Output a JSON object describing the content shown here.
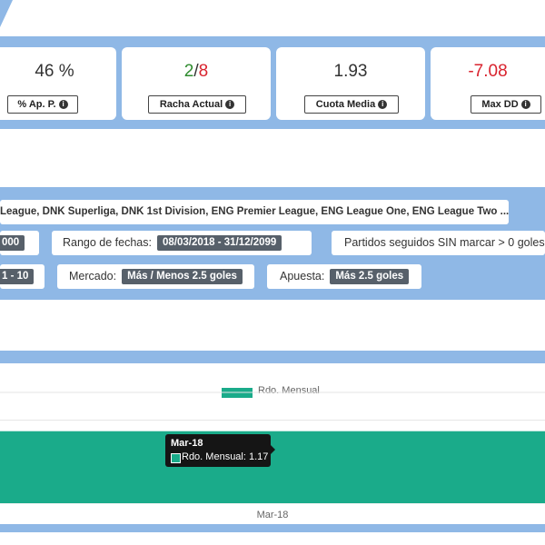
{
  "stats": [
    {
      "value": "46 %",
      "label": "% Ap. P."
    },
    {
      "value_current": "2",
      "value_sep": "/",
      "value_total": "8",
      "label": "Racha Actual"
    },
    {
      "value": "1.93",
      "label": "Cuota Media"
    },
    {
      "value": "-7.08",
      "label": "Max DD"
    }
  ],
  "filters": {
    "leagues": "League, DNK Superliga, DNK 1st Division, ENG Premier League, ENG League One, ENG League Two ...",
    "partial_left_1": "000",
    "date_range_label": "Rango de fechas:",
    "date_range_value": "08/03/2018 - 31/12/2099",
    "scoreless_label": "Partidos seguidos SIN marcar > 0 goles",
    "partial_left_2": "1 - 10",
    "market_label": "Mercado:",
    "market_value": "Más / Menos 2.5 goles",
    "bet_label": "Apuesta:",
    "bet_value": "Más 2.5 goles"
  },
  "chart_data": {
    "type": "bar",
    "categories": [
      "Mar-18"
    ],
    "series": [
      {
        "name": "Rdo. Mensual",
        "values": [
          1.17
        ],
        "color": "#1aab8a"
      }
    ],
    "title": "",
    "xlabel": "",
    "ylabel": "",
    "ylim": [
      0,
      1.8
    ],
    "grid": true,
    "legend": "top",
    "tooltip": {
      "title": "Mar-18",
      "text": "Rdo. Mensual: 1.17"
    }
  }
}
